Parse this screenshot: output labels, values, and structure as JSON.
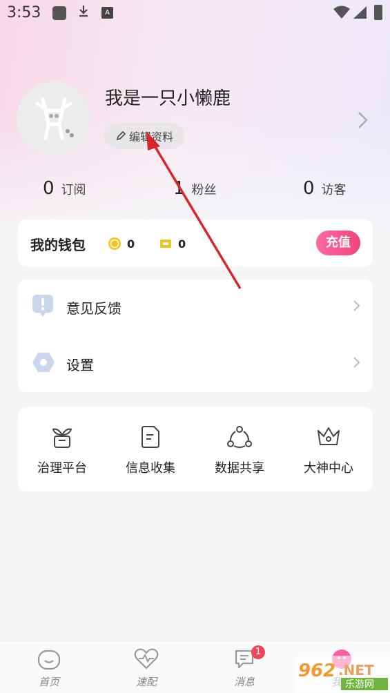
{
  "status_bar": {
    "time": "3:53",
    "a_badge": "A"
  },
  "profile": {
    "username": "我是一只小懒鹿",
    "edit_label": "编辑资料"
  },
  "stats": [
    {
      "value": "0",
      "label": "订阅"
    },
    {
      "value": "1",
      "label": "粉丝"
    },
    {
      "value": "0",
      "label": "访客"
    }
  ],
  "wallet": {
    "title": "我的钱包",
    "coins": "0",
    "tickets": "0",
    "recharge_label": "充值"
  },
  "menu": [
    {
      "label": "意见反馈",
      "icon": "feedback-icon"
    },
    {
      "label": "设置",
      "icon": "settings-icon"
    }
  ],
  "tools": [
    {
      "label": "治理平台",
      "icon": "plant-pot-icon"
    },
    {
      "label": "信息收集",
      "icon": "document-icon"
    },
    {
      "label": "数据共享",
      "icon": "share-nodes-icon"
    },
    {
      "label": "大神中心",
      "icon": "crown-icon"
    }
  ],
  "bottom_nav": [
    {
      "label": "首页",
      "icon": "home-face-icon"
    },
    {
      "label": "速配",
      "icon": "heart-pulse-icon"
    },
    {
      "label": "消息",
      "icon": "message-icon",
      "badge": "1"
    },
    {
      "label": "我的",
      "icon": "profile-icon"
    }
  ],
  "watermark": {
    "brand": "962.NET",
    "sub": "乐游网"
  },
  "colors": {
    "accent": "#f0457e",
    "arrow": "#d9262b",
    "badge": "#f0455a"
  }
}
